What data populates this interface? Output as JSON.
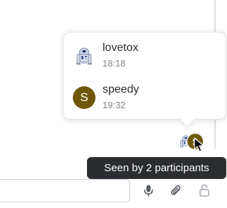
{
  "read_receipts": {
    "readers": [
      {
        "name": "lovetox",
        "time": "18:18",
        "avatar": "r2d2-robot-avatar"
      },
      {
        "name": "speedy",
        "time": "19:32",
        "avatar_letter": "S",
        "avatar_color": "#6e5808"
      }
    ],
    "stack_letter": "S"
  },
  "tooltip": {
    "text": "Seen by 2 participants"
  },
  "composer": {
    "placeholder": "",
    "icons": [
      "microphone-icon",
      "paperclip-icon",
      "unlocked-padlock-icon"
    ]
  },
  "colors": {
    "tooltip_bg": "#2b2d31",
    "avatar_letter_bg": "#6e5808",
    "icon_color": "#5c5f66"
  }
}
